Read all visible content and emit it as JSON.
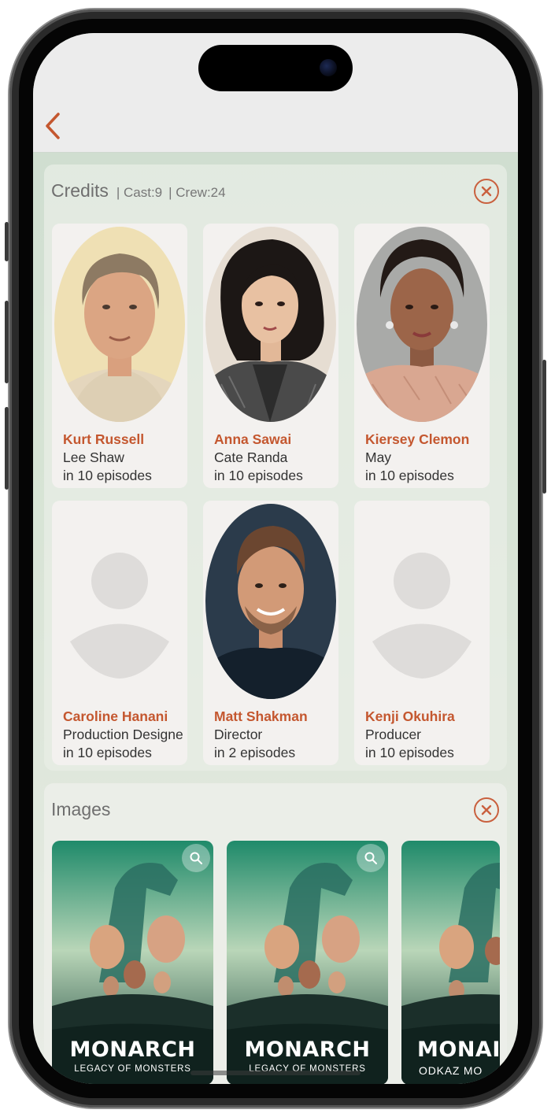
{
  "colors": {
    "accent": "#c4572f",
    "close": "#c9603e"
  },
  "nav": {
    "back_icon": "chevron-left-icon"
  },
  "credits": {
    "title": "Credits",
    "cast_meta": "| Cast:9",
    "crew_meta": "| Crew:24",
    "close_icon": "close-circle-icon",
    "people": [
      {
        "name": "Kurt Russell",
        "role": "Lee Shaw",
        "episodes": "in 10 episodes"
      },
      {
        "name": "Anna Sawai",
        "role": "Cate Randa",
        "episodes": "in 10 episodes"
      },
      {
        "name": "Kiersey Clemon",
        "role": "May",
        "episodes": "in 10 episodes"
      },
      {
        "name": "Caroline Hanani",
        "role": "Production Designer",
        "episodes": "in 10 episodes"
      },
      {
        "name": "Matt Shakman",
        "role": "Director",
        "episodes": "in 2 episodes"
      },
      {
        "name": "Kenji Okuhira",
        "role": "Producer",
        "episodes": "in 10 episodes"
      }
    ]
  },
  "images": {
    "title": "Images",
    "close_icon": "close-circle-icon",
    "posters": [
      {
        "title": "MONARCH",
        "subtitle": "LEGACY OF MONSTERS"
      },
      {
        "title": "MONARCH",
        "subtitle": "LEGACY OF MONSTERS"
      },
      {
        "title": "MONAI",
        "subtitle": "ODKAZ MO"
      }
    ]
  }
}
